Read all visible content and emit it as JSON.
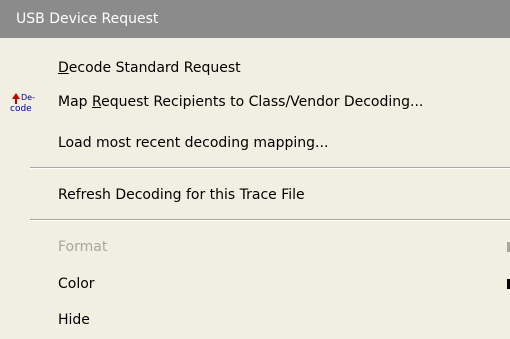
{
  "menu": {
    "header": "USB Device Request",
    "items": [
      {
        "label_pre": "",
        "label_mnemonic": "D",
        "label_post": "ecode Standard Request"
      },
      {
        "label_pre": "Map ",
        "label_mnemonic": "R",
        "label_post": "equest Recipients to Class/Vendor Decoding...",
        "icon": "decode-icon",
        "icon_text_top": "De-",
        "icon_text_bottom": "code"
      },
      {
        "label": "Load most recent decoding mapping..."
      },
      {
        "label": "Refresh Decoding for this Trace File"
      },
      {
        "label": "Format",
        "disabled": true,
        "submenu": true
      },
      {
        "label": "Color",
        "submenu": true
      },
      {
        "label": "Hide"
      }
    ]
  },
  "colors": {
    "header_bg": "#8b8b8b",
    "menu_bg": "#f1efe2",
    "disabled_text": "#a9a79b",
    "icon_arrow": "#c00000",
    "icon_text": "#00008b"
  }
}
